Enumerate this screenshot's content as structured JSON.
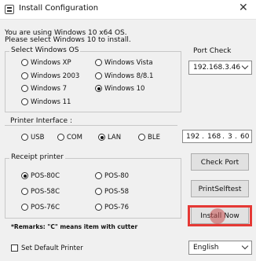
{
  "window": {
    "title": "Install Configuration",
    "close_glyph": "✕"
  },
  "message": {
    "line1": "You are using Windows 10 x64 OS.",
    "line2": "Please select Windows 10 to install."
  },
  "select_os": {
    "label": "Select Windows OS",
    "options": [
      {
        "label": "Windows XP",
        "selected": false
      },
      {
        "label": "Windows Vista",
        "selected": false
      },
      {
        "label": "Windows 2003",
        "selected": false
      },
      {
        "label": "Windows 8/8.1",
        "selected": false
      },
      {
        "label": "Windows 7",
        "selected": false
      },
      {
        "label": "Windows 10",
        "selected": true
      },
      {
        "label": "Windows 11",
        "selected": false
      }
    ]
  },
  "port_check": {
    "label": "Port Check",
    "value": "192.168.3.46"
  },
  "printer_interface": {
    "label": "Printer Interface :",
    "options": [
      {
        "label": "USB",
        "selected": false
      },
      {
        "label": "COM",
        "selected": false
      },
      {
        "label": "LAN",
        "selected": true
      },
      {
        "label": "BLE",
        "selected": false
      }
    ],
    "ip": {
      "a": "192",
      "b": "168",
      "c": "3",
      "d": "60",
      "dot": "."
    }
  },
  "receipt_printer": {
    "label": "Receipt printer",
    "options": [
      {
        "label": "POS-80C",
        "selected": true
      },
      {
        "label": "POS-80",
        "selected": false
      },
      {
        "label": "POS-58C",
        "selected": false
      },
      {
        "label": "POS-58",
        "selected": false
      },
      {
        "label": "POS-76C",
        "selected": false
      },
      {
        "label": "POS-76",
        "selected": false
      }
    ],
    "remarks": "*Remarks: \"C\" means item with cutter"
  },
  "buttons": {
    "check_port": "Check Port",
    "print_selftest": "PrintSelftest",
    "install_now": "Install Now"
  },
  "default_printer": {
    "label": "Set Default Printer",
    "checked": false
  },
  "language": {
    "value": "English"
  },
  "colors": {
    "highlight": "#e53935",
    "background": "#f0f0f0"
  }
}
